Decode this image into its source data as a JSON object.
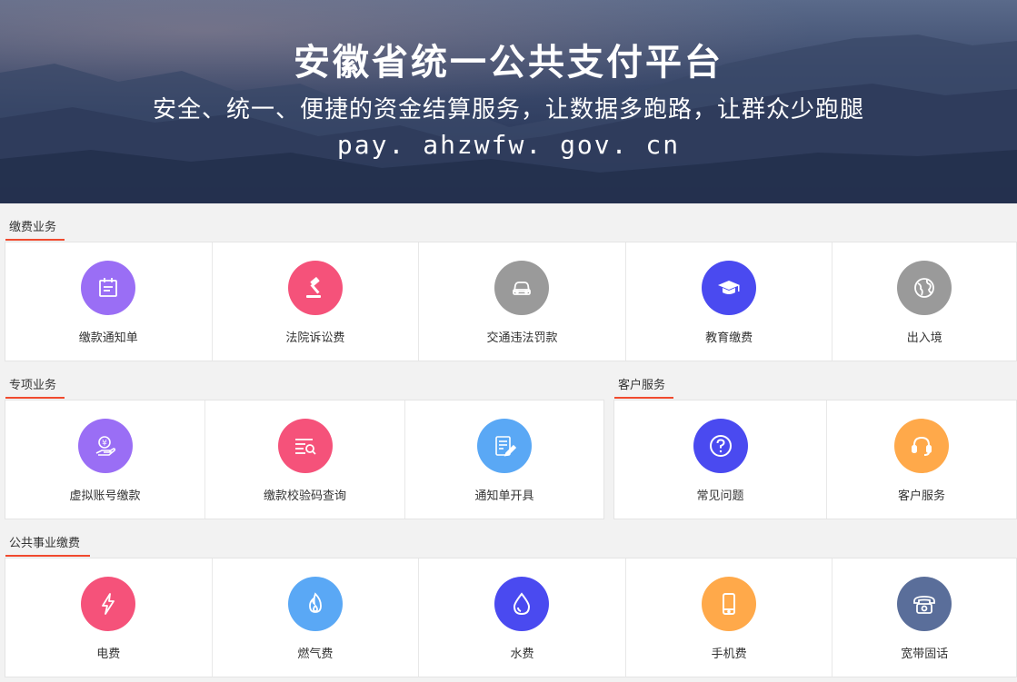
{
  "hero": {
    "title": "安徽省统一公共支付平台",
    "subtitle": "安全、统一、便捷的资金结算服务，让数据多跑路，让群众少跑腿",
    "url": "pay. ahzwfw. gov. cn"
  },
  "sections": {
    "fees": {
      "title": "缴费业务",
      "items": [
        {
          "label": "缴款通知单",
          "icon": "notice-icon",
          "color": "#9a6ef5"
        },
        {
          "label": "法院诉讼费",
          "icon": "gavel-icon",
          "color": "#f5527a"
        },
        {
          "label": "交通违法罚款",
          "icon": "car-icon",
          "color": "#9a9a9a"
        },
        {
          "label": "教育缴费",
          "icon": "graduation-cap-icon",
          "color": "#4a4af0"
        },
        {
          "label": "出入境",
          "icon": "globe-icon",
          "color": "#9a9a9a"
        }
      ]
    },
    "special": {
      "title": "专项业务",
      "items": [
        {
          "label": "虚拟账号缴款",
          "icon": "yuan-hand-icon",
          "color": "#9a6ef5"
        },
        {
          "label": "缴款校验码查询",
          "icon": "list-search-icon",
          "color": "#f5527a"
        },
        {
          "label": "通知单开具",
          "icon": "form-edit-icon",
          "color": "#5aa8f5"
        }
      ]
    },
    "customer": {
      "title": "客户服务",
      "items": [
        {
          "label": "常见问题",
          "icon": "question-icon",
          "color": "#4a4af0"
        },
        {
          "label": "客户服务",
          "icon": "headset-icon",
          "color": "#ffa94a"
        }
      ]
    },
    "utilities": {
      "title": "公共事业缴费",
      "items": [
        {
          "label": "电费",
          "icon": "lightning-icon",
          "color": "#f5527a"
        },
        {
          "label": "燃气费",
          "icon": "flame-icon",
          "color": "#5aa8f5"
        },
        {
          "label": "水费",
          "icon": "water-drop-icon",
          "color": "#4a4af0"
        },
        {
          "label": "手机费",
          "icon": "phone-icon",
          "color": "#ffa94a"
        },
        {
          "label": "宽带固话",
          "icon": "telephone-icon",
          "color": "#5a6e9a"
        }
      ]
    }
  }
}
